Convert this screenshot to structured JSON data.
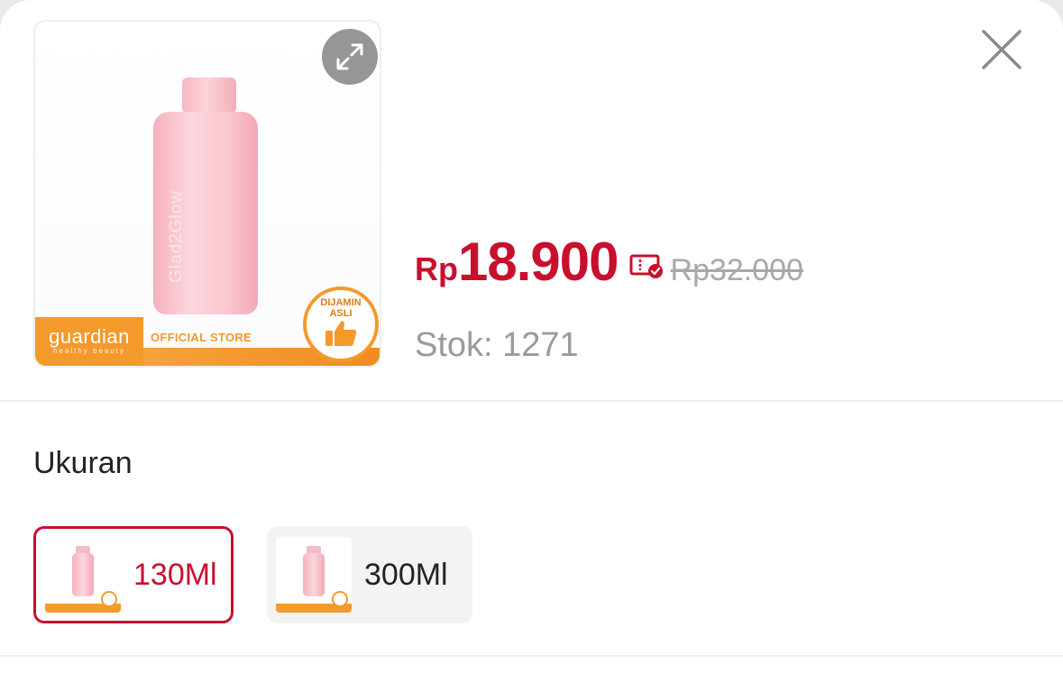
{
  "product": {
    "image_alt": "Glow bottle product image",
    "bottle_text": "Glad2Glow",
    "brand_name": "guardian",
    "brand_tagline": "healthy beauty",
    "store_label": "OFFICIAL STORE",
    "badge_line1": "DIJAMIN",
    "badge_line2": "ASLI"
  },
  "price": {
    "currency": "Rp",
    "amount": "18.900",
    "original": "Rp32.000"
  },
  "stock": "Stok: 1271",
  "variants_section": {
    "title": "Ukuran",
    "options": [
      {
        "label": "130Ml",
        "selected": true
      },
      {
        "label": "300Ml",
        "selected": false
      }
    ]
  },
  "colors": {
    "accent": "#c8102e",
    "brand_orange": "#f39a2b",
    "muted": "#9a9a9a"
  }
}
